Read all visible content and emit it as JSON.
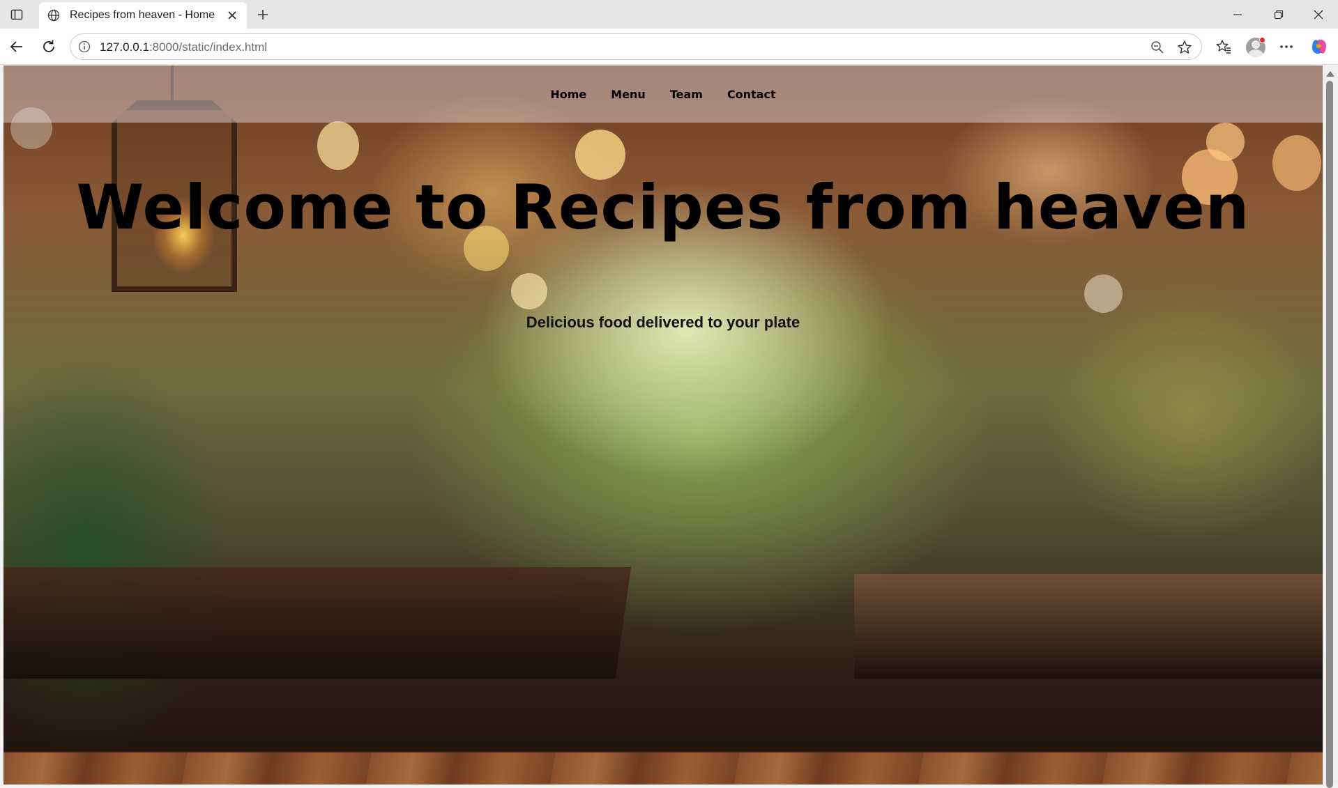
{
  "browser": {
    "tab_title": "Recipes from heaven - Home",
    "url_host": "127.0.0.1",
    "url_rest": ":8000/static/index.html"
  },
  "nav": {
    "items": [
      {
        "label": "Home"
      },
      {
        "label": "Menu"
      },
      {
        "label": "Team"
      },
      {
        "label": "Contact"
      }
    ]
  },
  "hero": {
    "title": "Welcome to Recipes from heaven",
    "subtitle": "Delicious food delivered to your plate"
  },
  "colors": {
    "nav_text": "#000000",
    "title_text": "#000000",
    "avatar_badge": "#d93025"
  },
  "icons": [
    "sidebar-toggle-icon",
    "globe-icon",
    "close-icon",
    "plus-icon",
    "minimize-icon",
    "restore-icon",
    "window-close-icon",
    "back-icon",
    "reload-icon",
    "info-icon",
    "zoom-out-icon",
    "star-icon",
    "favorites-icon",
    "profile-icon",
    "more-icon",
    "copilot-icon"
  ]
}
